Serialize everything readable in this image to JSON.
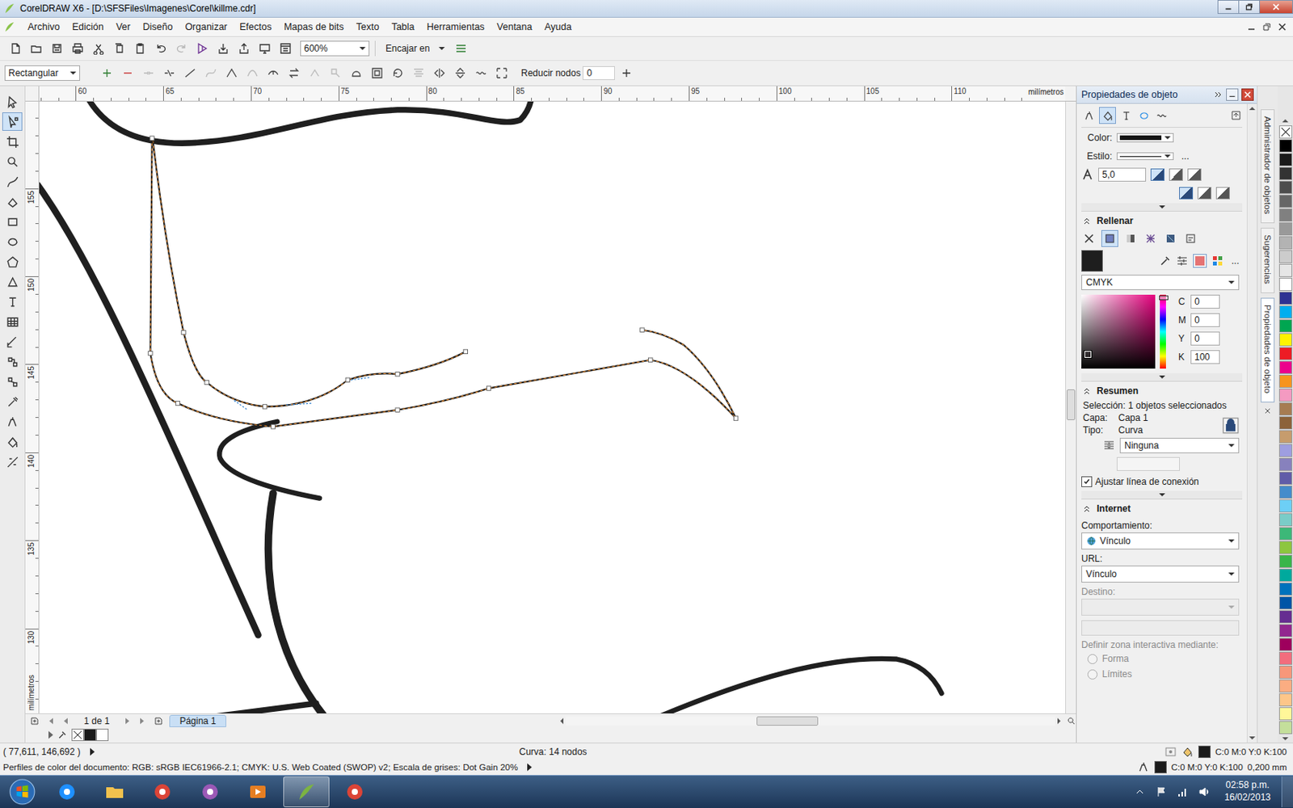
{
  "window": {
    "title": "CorelDRAW X6 - [D:\\SFSFiles\\Imagenes\\Corel\\killme.cdr]"
  },
  "menu": [
    "Archivo",
    "Edición",
    "Ver",
    "Diseño",
    "Organizar",
    "Efectos",
    "Mapas de bits",
    "Texto",
    "Tabla",
    "Herramientas",
    "Ventana",
    "Ayuda"
  ],
  "standard_toolbar": {
    "buttons": [
      {
        "kind": "new",
        "disabled": false
      },
      {
        "kind": "open",
        "disabled": false
      },
      {
        "kind": "save",
        "disabled": false
      },
      {
        "kind": "print",
        "disabled": false
      },
      {
        "kind": "cut",
        "disabled": false
      },
      {
        "kind": "copy",
        "disabled": false
      },
      {
        "kind": "paste",
        "disabled": false
      },
      {
        "kind": "undo",
        "disabled": false
      },
      {
        "kind": "redo",
        "disabled": true
      },
      {
        "kind": "search",
        "disabled": false
      },
      {
        "kind": "import",
        "disabled": false
      },
      {
        "kind": "export",
        "disabled": false
      },
      {
        "kind": "launcher",
        "disabled": false
      },
      {
        "kind": "welcome",
        "disabled": false
      }
    ],
    "zoom": "600%",
    "snap": "Encajar en"
  },
  "property_bar": {
    "selection_mode": "Rectangular",
    "node_tools": [
      {
        "kind": "add",
        "disabled": false
      },
      {
        "kind": "delete",
        "disabled": false
      },
      {
        "kind": "join",
        "disabled": true
      },
      {
        "kind": "break",
        "disabled": false
      },
      {
        "kind": "to-line",
        "disabled": false
      },
      {
        "kind": "to-curve",
        "disabled": true
      },
      {
        "kind": "cusp",
        "disabled": false
      },
      {
        "kind": "smooth",
        "disabled": true
      },
      {
        "kind": "symmetric",
        "disabled": false
      },
      {
        "kind": "reverse",
        "disabled": false
      },
      {
        "kind": "extend",
        "disabled": true
      },
      {
        "kind": "extract",
        "disabled": true
      },
      {
        "kind": "close",
        "disabled": false
      },
      {
        "kind": "stretch",
        "disabled": false
      },
      {
        "kind": "rotate",
        "disabled": false
      },
      {
        "kind": "align",
        "disabled": true
      },
      {
        "kind": "mirror-h",
        "disabled": false
      },
      {
        "kind": "mirror-v",
        "disabled": false
      },
      {
        "kind": "elastic",
        "disabled": false
      },
      {
        "kind": "select-all",
        "disabled": false
      }
    ],
    "reduce_nodes_label": "Reducir nodos",
    "reduce_nodes_value": "0"
  },
  "toolbox": [
    {
      "kind": "pick",
      "selected": false
    },
    {
      "kind": "shape",
      "selected": true
    },
    {
      "kind": "crop",
      "selected": false
    },
    {
      "kind": "zoom",
      "selected": false
    },
    {
      "kind": "freehand",
      "selected": false
    },
    {
      "kind": "smartfill",
      "selected": false
    },
    {
      "kind": "rectangle",
      "selected": false
    },
    {
      "kind": "ellipse",
      "selected": false
    },
    {
      "kind": "polygon",
      "selected": false
    },
    {
      "kind": "basic",
      "selected": false
    },
    {
      "kind": "text",
      "selected": false
    },
    {
      "kind": "table",
      "selected": false
    },
    {
      "kind": "dimension",
      "selected": false
    },
    {
      "kind": "connector",
      "selected": false
    },
    {
      "kind": "blend",
      "selected": false
    },
    {
      "kind": "eyedropper",
      "selected": false
    },
    {
      "kind": "outline",
      "selected": false
    },
    {
      "kind": "fill",
      "selected": false
    },
    {
      "kind": "interactivefill",
      "selected": false
    }
  ],
  "rulers": {
    "unit": "milímetros",
    "horizontal": [
      "60",
      "65",
      "70",
      "75",
      "80",
      "85",
      "90",
      "95",
      "100",
      "105",
      "110"
    ],
    "vertical": [
      "155",
      "150",
      "145",
      "140",
      "135",
      "130"
    ]
  },
  "canvas": {
    "curves": [
      {
        "selected": false
      },
      {
        "selected": false
      },
      {
        "selected": false
      },
      {
        "selected": false
      },
      {
        "selected": false
      },
      {
        "selected": false
      },
      {
        "selected": true
      },
      {
        "selected": true
      }
    ]
  },
  "pages": {
    "count": "1 de 1",
    "tabs": [
      {
        "label": "Página 1",
        "selected": true
      }
    ]
  },
  "document_palette": [
    {
      "color": "#1a1a1a"
    },
    {
      "color": "#ffffff"
    }
  ],
  "docker": {
    "title": "Propiedades de objeto",
    "outline": {
      "color_label": "Color:",
      "style_label": "Estilo:",
      "width": "5,0",
      "more": "..."
    },
    "fill": {
      "title": "Rellenar",
      "swatch": "#1e1e1e",
      "more": "...",
      "model": "CMYK",
      "channels": [
        {
          "name": "C",
          "value": "0"
        },
        {
          "name": "M",
          "value": "0"
        },
        {
          "name": "Y",
          "value": "0"
        },
        {
          "name": "K",
          "value": "100"
        }
      ]
    },
    "summary": {
      "title": "Resumen",
      "selection": "Selección: 1 objetos seleccionados",
      "layer_label": "Capa:",
      "layer": "Capa 1",
      "type_label": "Tipo:",
      "type": "Curva",
      "wrap": "Ninguna",
      "adjust_connector": {
        "label": "Ajustar línea de conexión",
        "checked": true
      }
    },
    "internet": {
      "title": "Internet",
      "behavior_label": "Comportamiento:",
      "behavior": "Vínculo",
      "url_label": "URL:",
      "url": "Vínculo",
      "target_label": "Destino:",
      "hotspot_label": "Definir zona interactiva mediante:",
      "hotspot_options": [
        {
          "label": "Forma",
          "selected": false,
          "disabled": true
        },
        {
          "label": "Límites",
          "selected": false,
          "disabled": true
        }
      ]
    }
  },
  "side_tabs": [
    {
      "label": "Administrador de objetos",
      "selected": false
    },
    {
      "label": "Sugerencias",
      "selected": false
    },
    {
      "label": "Propiedades de objeto",
      "selected": true
    }
  ],
  "palette": [
    {
      "color": "#000000"
    },
    {
      "color": "#1a1a1a"
    },
    {
      "color": "#333333"
    },
    {
      "color": "#4d4d4d"
    },
    {
      "color": "#666666"
    },
    {
      "color": "#808080"
    },
    {
      "color": "#999999"
    },
    {
      "color": "#b3b3b3"
    },
    {
      "color": "#cccccc"
    },
    {
      "color": "#e6e6e6"
    },
    {
      "color": "#ffffff"
    },
    {
      "color": "#2e3192"
    },
    {
      "color": "#00aeef"
    },
    {
      "color": "#00a651"
    },
    {
      "color": "#fff200"
    },
    {
      "color": "#ed1c24"
    },
    {
      "color": "#ec008c"
    },
    {
      "color": "#f7941d"
    },
    {
      "color": "#f49ac1"
    },
    {
      "color": "#a67c52"
    },
    {
      "color": "#8c6239"
    },
    {
      "color": "#c69c6d"
    },
    {
      "color": "#9e9ee0"
    },
    {
      "color": "#8781bd"
    },
    {
      "color": "#605ca8"
    },
    {
      "color": "#448ccb"
    },
    {
      "color": "#6dcff6"
    },
    {
      "color": "#7accc8"
    },
    {
      "color": "#3cb878"
    },
    {
      "color": "#8dc63f"
    },
    {
      "color": "#39b54a"
    },
    {
      "color": "#00a99d"
    },
    {
      "color": "#0072bc"
    },
    {
      "color": "#0054a6"
    },
    {
      "color": "#662d91"
    },
    {
      "color": "#92278f"
    },
    {
      "color": "#9e005d"
    },
    {
      "color": "#f26d7d"
    },
    {
      "color": "#f7977a"
    },
    {
      "color": "#fbad82"
    },
    {
      "color": "#fdc689"
    },
    {
      "color": "#fff799"
    },
    {
      "color": "#c4df9b"
    }
  ],
  "status_bar": {
    "coordinates": "( 77,611, 146,692 )",
    "object_info": "Curva: 14 nodos",
    "fill_color": "#1a1a1a",
    "fill": "C:0 M:0 Y:0 K:100",
    "outline_color": "#1a1a1a",
    "outline": "C:0 M:0 Y:0 K:100",
    "outline_width": "0,200 mm",
    "color_profiles": "Perfiles de color del documento: RGB: sRGB IEC61966-2.1; CMYK: U.S. Web Coated (SWOP) v2; Escala de grises: Dot Gain 20%"
  },
  "taskbar": {
    "apps": [
      {
        "kind": "ie",
        "selected": false
      },
      {
        "kind": "folder",
        "selected": false
      },
      {
        "kind": "chrome",
        "selected": false
      },
      {
        "kind": "paint",
        "selected": false
      },
      {
        "kind": "media",
        "selected": false
      },
      {
        "kind": "corel",
        "selected": true
      },
      {
        "kind": "chrome",
        "selected": false
      }
    ],
    "time": "02:58 p.m.",
    "date": "16/02/2013"
  }
}
